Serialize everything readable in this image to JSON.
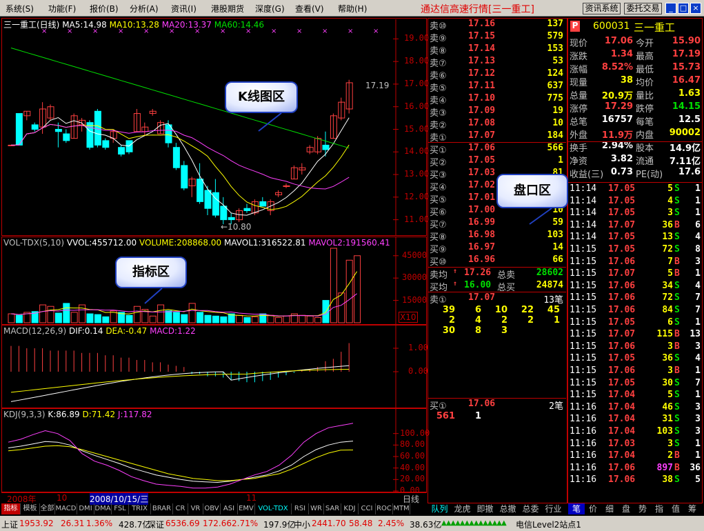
{
  "menu": [
    "系统(S)",
    "功能(F)",
    "报价(B)",
    "分析(A)",
    "资讯(I)",
    "港股期货",
    "深度(G)",
    "查看(V)",
    "帮助(H)"
  ],
  "app_title": "通达信高速行情",
  "app_title_stock": "[三一重工]",
  "btn_news": "资讯系统",
  "btn_trade": "委托交易",
  "kline": {
    "name": "三一重工(日线)",
    "ma5": "MA5:14.98",
    "ma10": "MA10:13.28",
    "ma20": "MA20:13.37",
    "ma60": "MA60:14.46",
    "yticks": [
      "19.00",
      "18.00",
      "17.00",
      "16.00",
      "15.00",
      "14.00",
      "13.00",
      "12.00",
      "11.00"
    ],
    "high_label": "17.19",
    "low_label": "←10.80"
  },
  "vol": {
    "hdr1": "VOL-TDX(5,10)",
    "hdr2": "VVOL:455712.00",
    "hdr3": "VOLUME:208868.00",
    "hdr4": "MAVOL1:316522.81",
    "hdr5": "MAVOL2:191560.41",
    "yticks": [
      "45000",
      "30000",
      "15000"
    ],
    "unit": "X10"
  },
  "macd": {
    "hdr1": "MACD(12,26,9)",
    "hdr2": "DIF:0.14",
    "hdr3": "DEA:-0.47",
    "hdr4": "MACD:1.22",
    "yticks": [
      "1.00",
      "0.00"
    ]
  },
  "kdj": {
    "hdr1": "KDJ(9,3,3)",
    "hdr2": "K:86.89",
    "hdr3": "D:71.42",
    "hdr4": "J:117.82",
    "yticks": [
      "100.00",
      "80.00",
      "60.00",
      "40.00",
      "20.00",
      "0.00"
    ]
  },
  "timeline": {
    "y1": "2008年",
    "m1": "10",
    "cursor": "2008/10/15/三",
    "m2": "11",
    "period": "日线"
  },
  "bottom_tabs": [
    "指标",
    "模板",
    "全部",
    "MACD",
    "DMI",
    "DMA",
    "FSL",
    "TRIX",
    "BRAR",
    "CR",
    "VR",
    "OBV",
    "ASI",
    "EMV",
    "VOL-TDX",
    "RSI",
    "WR",
    "SAR",
    "KDJ",
    "CCI",
    "ROC",
    "MTM"
  ],
  "sell_book": [
    {
      "label": "卖⑩",
      "price": "17.16",
      "vol": "137"
    },
    {
      "label": "卖⑨",
      "price": "17.15",
      "vol": "579"
    },
    {
      "label": "卖⑧",
      "price": "17.14",
      "vol": "153"
    },
    {
      "label": "卖⑦",
      "price": "17.13",
      "vol": "53"
    },
    {
      "label": "卖⑥",
      "price": "17.12",
      "vol": "124"
    },
    {
      "label": "卖⑤",
      "price": "17.11",
      "vol": "637"
    },
    {
      "label": "卖④",
      "price": "17.10",
      "vol": "775"
    },
    {
      "label": "卖③",
      "price": "17.09",
      "vol": "19"
    },
    {
      "label": "卖②",
      "price": "17.08",
      "vol": "10"
    },
    {
      "label": "卖①",
      "price": "17.07",
      "vol": "184"
    }
  ],
  "buy_book": [
    {
      "label": "买①",
      "price": "17.06",
      "vol": "566"
    },
    {
      "label": "买②",
      "price": "17.05",
      "vol": "1"
    },
    {
      "label": "买③",
      "price": "17.03",
      "vol": "81"
    },
    {
      "label": "买④",
      "price": "17.02",
      "vol": ""
    },
    {
      "label": "买⑤",
      "price": "17.01",
      "vol": ""
    },
    {
      "label": "买⑥",
      "price": "17.00",
      "vol": "10"
    },
    {
      "label": "买⑦",
      "price": "16.99",
      "vol": "59"
    },
    {
      "label": "买⑧",
      "price": "16.98",
      "vol": "103"
    },
    {
      "label": "买⑨",
      "price": "16.97",
      "vol": "14"
    },
    {
      "label": "买⑩",
      "price": "16.96",
      "vol": "66"
    }
  ],
  "avg": {
    "sell_label": "卖均",
    "sell_price": "17.26",
    "sell_total_label": "总卖",
    "sell_total": "28602",
    "buy_label": "买均",
    "buy_price": "16.00",
    "buy_total_label": "总买",
    "buy_total": "24874"
  },
  "queue1": {
    "label": "卖①",
    "price": "17.07",
    "count": "13笔",
    "rows": [
      [
        "39",
        "6",
        "10",
        "22",
        "45"
      ],
      [
        "2",
        "4",
        "2",
        "2",
        "1"
      ],
      [
        "30",
        "8",
        "3",
        "",
        ""
      ]
    ]
  },
  "queue2": {
    "label": "买①",
    "price": "17.06",
    "count": "2笔",
    "rows": [
      [
        "561",
        "1"
      ]
    ]
  },
  "right_tabs_mid": [
    "队列",
    "龙虎",
    "即撤",
    "总撤",
    "总委",
    "行业"
  ],
  "stock": {
    "flag": "P",
    "code": "600031",
    "name": "三一重工"
  },
  "quote": [
    [
      "现价",
      "17.06",
      "今开",
      "15.90"
    ],
    [
      "涨跌",
      "1.34",
      "最高",
      "17.19"
    ],
    [
      "涨幅",
      "8.52%",
      "最低",
      "15.73"
    ],
    [
      "现量",
      "38",
      "均价",
      "16.47"
    ],
    [
      "总量",
      "20.9万",
      "量比",
      "1.63"
    ],
    [
      "涨停",
      "17.29",
      "跌停",
      "14.15"
    ],
    [
      "总笔",
      "16757",
      "每笔",
      "12.5"
    ],
    [
      "外盘",
      "11.9万",
      "内盘",
      "90002"
    ],
    [
      "换手",
      "2.94%",
      "股本",
      "14.9亿"
    ],
    [
      "净资",
      "3.82",
      "流通",
      "7.11亿"
    ],
    [
      "收益(三)",
      "0.73",
      "PE(动)",
      "17.6"
    ]
  ],
  "ticks": [
    [
      "11:14",
      "17.05",
      "5",
      "S",
      "1"
    ],
    [
      "11:14",
      "17.05",
      "4",
      "S",
      "1"
    ],
    [
      "11:14",
      "17.05",
      "3",
      "S",
      "1"
    ],
    [
      "11:14",
      "17.07",
      "36",
      "B",
      "6"
    ],
    [
      "11:14",
      "17.05",
      "13",
      "S",
      "4"
    ],
    [
      "11:15",
      "17.05",
      "72",
      "S",
      "8"
    ],
    [
      "11:15",
      "17.06",
      "7",
      "B",
      "3"
    ],
    [
      "11:15",
      "17.07",
      "5",
      "B",
      "1"
    ],
    [
      "11:15",
      "17.06",
      "34",
      "S",
      "4"
    ],
    [
      "11:15",
      "17.06",
      "72",
      "S",
      "7"
    ],
    [
      "11:15",
      "17.06",
      "84",
      "S",
      "7"
    ],
    [
      "11:15",
      "17.05",
      "6",
      "S",
      "1"
    ],
    [
      "11:15",
      "17.07",
      "115",
      "B",
      "13"
    ],
    [
      "11:15",
      "17.06",
      "3",
      "B",
      "3"
    ],
    [
      "11:15",
      "17.05",
      "36",
      "S",
      "4"
    ],
    [
      "11:15",
      "17.06",
      "3",
      "B",
      "1"
    ],
    [
      "11:15",
      "17.05",
      "30",
      "S",
      "7"
    ],
    [
      "11:15",
      "17.04",
      "5",
      "S",
      "1"
    ],
    [
      "11:16",
      "17.04",
      "46",
      "S",
      "3"
    ],
    [
      "11:16",
      "17.04",
      "31",
      "S",
      "3"
    ],
    [
      "11:16",
      "17.04",
      "103",
      "S",
      "3"
    ],
    [
      "11:16",
      "17.03",
      "3",
      "S",
      "1"
    ],
    [
      "11:16",
      "17.04",
      "2",
      "B",
      "1"
    ],
    [
      "11:16",
      "17.06",
      "897",
      "B",
      "36"
    ],
    [
      "11:16",
      "17.06",
      "38",
      "S",
      "5"
    ]
  ],
  "right_tabs_bottom": [
    "笔",
    "价",
    "细",
    "盘",
    "势",
    "指",
    "值",
    "筹"
  ],
  "status": {
    "sh_label": "上证",
    "sh_val": "1953.92",
    "sh_chg": "26.31",
    "sh_pct": "1.36%",
    "sh_amt": "428.7亿",
    "sz_label": "深证",
    "sz_val": "6536.69",
    "sz_chg": "172.66",
    "sz_pct": "2.71%",
    "sz_amt": "197.9亿",
    "zx_label": "中小",
    "zx_val": "2441.70",
    "zx_chg": "58.48",
    "zx_pct": "2.45%",
    "zx_amt": "38.63亿",
    "server": "电信Level2站点1"
  },
  "callouts": {
    "kline": "K线图区",
    "indicator": "指标区",
    "orderbook": "盘口区"
  },
  "colors": {
    "up": "#ff4040",
    "down": "#00e000",
    "frame": "#c00000",
    "ma5": "#ffffff",
    "ma10": "#ffff00",
    "ma20": "#ff40ff",
    "ma60": "#00e000",
    "bear": "#00ffff"
  },
  "chart_data": [
    {
      "type": "candlestick",
      "title": "三一重工(日线)",
      "ylim": [
        10.5,
        19.5
      ],
      "candles": [
        [
          14.3,
          14.3,
          14.3,
          14.3
        ],
        [
          15.7,
          15.7,
          14.3,
          14.3
        ],
        [
          15.6,
          15.8,
          15.4,
          15.8
        ],
        [
          15.2,
          15.3,
          14.9,
          15.0
        ],
        [
          15.1,
          16.2,
          14.8,
          15.9
        ],
        [
          15.5,
          16.1,
          15.4,
          16.0
        ],
        [
          15.0,
          15.3,
          14.2,
          14.9
        ],
        [
          14.8,
          15.0,
          14.4,
          14.5
        ],
        [
          14.6,
          15.7,
          14.6,
          15.6
        ],
        [
          15.2,
          15.5,
          14.9,
          15.4
        ],
        [
          15.3,
          15.4,
          14.1,
          14.2
        ],
        [
          15.8,
          15.9,
          14.2,
          14.3
        ],
        [
          14.5,
          14.6,
          14.1,
          14.2
        ],
        [
          14.6,
          15.0,
          14.4,
          14.9
        ],
        [
          14.2,
          14.3,
          13.8,
          13.9
        ],
        [
          14.5,
          14.5,
          13.9,
          14.0
        ],
        [
          14.9,
          15.9,
          14.9,
          15.7
        ],
        [
          14.9,
          15.3,
          14.7,
          15.1
        ],
        [
          15.7,
          15.9,
          15.6,
          15.8
        ],
        [
          14.8,
          15.4,
          14.8,
          15.3
        ],
        [
          15.2,
          15.4,
          14.2,
          14.4
        ],
        [
          14.2,
          14.4,
          13.2,
          13.3
        ],
        [
          13.4,
          13.6,
          12.3,
          12.4
        ],
        [
          12.5,
          12.9,
          12.0,
          12.8
        ],
        [
          12.8,
          13.5,
          11.7,
          11.8
        ],
        [
          12.3,
          12.5,
          11.2,
          11.5
        ],
        [
          12.2,
          12.8,
          11.1,
          11.2
        ],
        [
          11.6,
          12.0,
          10.8,
          11.0
        ],
        [
          11.1,
          11.3,
          10.8,
          11.0
        ],
        [
          11.0,
          11.5,
          10.9,
          11.4
        ],
        [
          11.5,
          11.7,
          11.3,
          11.4
        ],
        [
          11.3,
          11.9,
          11.2,
          11.8
        ],
        [
          11.8,
          12.0,
          11.6,
          11.6
        ],
        [
          11.4,
          11.9,
          11.2,
          11.8
        ],
        [
          12.1,
          12.3,
          12.0,
          12.2
        ],
        [
          12.5,
          12.6,
          12.4,
          12.5
        ],
        [
          12.8,
          13.4,
          12.8,
          13.3
        ],
        [
          13.2,
          13.5,
          13.0,
          13.3
        ],
        [
          14.0,
          14.3,
          13.9,
          14.2
        ],
        [
          14.0,
          14.7,
          13.9,
          14.6
        ],
        [
          14.3,
          14.9,
          13.8,
          14.1
        ],
        [
          14.6,
          15.7,
          14.6,
          15.6
        ],
        [
          15.5,
          16.4,
          15.4,
          16.2
        ],
        [
          15.9,
          17.19,
          15.7,
          17.06
        ]
      ]
    },
    {
      "type": "bar",
      "title": "VOL-TDX(5,10)",
      "ylim": [
        0,
        50000
      ],
      "values": [
        6000,
        5000,
        7000,
        7500,
        12000,
        11000,
        6500,
        13000,
        7000,
        12000,
        6000,
        5500,
        4000,
        8000,
        7000,
        5000,
        11000,
        9000,
        4500,
        12000,
        8000,
        7000,
        5500,
        13000,
        7000,
        5000,
        4500,
        4000,
        6000,
        5000,
        3500,
        4000,
        6000,
        5000,
        3500,
        4500,
        6000,
        5000,
        4500,
        3500,
        15000,
        50000,
        20000,
        42000,
        45000
      ]
    },
    {
      "type": "bar",
      "title": "MACD(12,26,9)",
      "ylim": [
        -1.5,
        1.5
      ],
      "values": [
        1.1,
        1.1,
        1.0,
        1.0,
        1.0,
        0.9,
        0.9,
        0.9,
        0.9,
        0.8,
        0.8,
        0.8,
        0.7,
        0.7,
        0.6,
        0.6,
        0.5,
        0.5,
        0.4,
        0.4,
        0.3,
        0.25,
        0.2,
        -0.1,
        -0.1,
        -0.2,
        -0.2,
        -0.25,
        -0.35,
        -0.4,
        -0.45,
        -0.45,
        -0.4,
        -0.35,
        -0.25,
        -0.15,
        -0.05,
        0.05,
        0.1,
        0.2,
        0.45,
        0.55,
        0.85,
        1.22
      ]
    },
    {
      "type": "line",
      "title": "KDJ(9,3,3)",
      "ylim": [
        0,
        110
      ],
      "series": [
        {
          "name": "K",
          "values": [
            75,
            78,
            82,
            86,
            85,
            80,
            70,
            62,
            55,
            48,
            40,
            34,
            28,
            24,
            20,
            17,
            16,
            15,
            17,
            20,
            24,
            28,
            35,
            45,
            60,
            72,
            80,
            85,
            86.89
          ]
        },
        {
          "name": "D",
          "values": [
            70,
            72,
            75,
            78,
            79,
            77,
            72,
            66,
            60,
            54,
            48,
            42,
            36,
            30,
            26,
            22,
            20,
            18,
            18,
            20,
            22,
            26,
            30,
            38,
            48,
            58,
            66,
            71,
            71.42
          ]
        },
        {
          "name": "J",
          "values": [
            85,
            90,
            98,
            105,
            100,
            88,
            65,
            52,
            45,
            36,
            25,
            18,
            12,
            10,
            8,
            5,
            5,
            7,
            12,
            20,
            28,
            34,
            45,
            62,
            85,
            100,
            110,
            114,
            117.82
          ]
        }
      ]
    }
  ]
}
